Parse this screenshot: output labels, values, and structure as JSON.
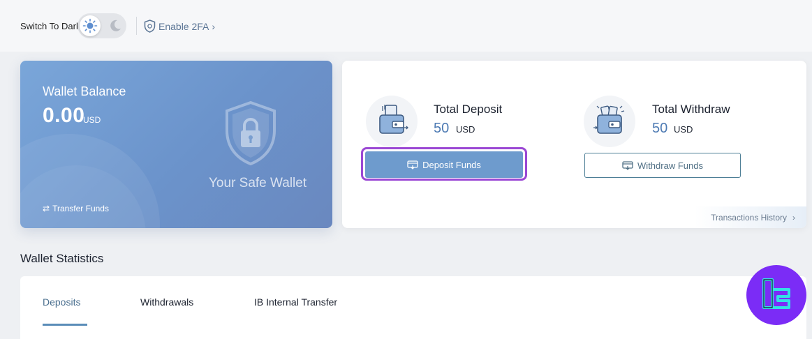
{
  "header": {
    "switch_label": "Switch To Dark",
    "twofa_label": "Enable 2FA",
    "twofa_chevron": "›"
  },
  "wallet": {
    "title": "Wallet Balance",
    "amount": "0.00",
    "currency": "USD",
    "tagline": "Your Safe Wallet",
    "transfer_label": "Transfer Funds",
    "transfer_icon": "⇄"
  },
  "summary": {
    "deposit": {
      "label": "Total Deposit",
      "value": "50",
      "currency": "USD",
      "button": "Deposit Funds"
    },
    "withdraw": {
      "label": "Total Withdraw",
      "value": "50",
      "currency": "USD",
      "button": "Withdraw Funds"
    },
    "history_label": "Transactions History",
    "history_chevron": "›"
  },
  "stats": {
    "title": "Wallet Statistics",
    "tabs": [
      {
        "label": "Deposits",
        "active": true
      },
      {
        "label": "Withdrawals",
        "active": false
      },
      {
        "label": "IB Internal Transfer",
        "active": false
      }
    ]
  },
  "colors": {
    "accent": "#6e9bcd",
    "highlight": "#9b48d4",
    "logo_bg": "#7b2cf6"
  }
}
